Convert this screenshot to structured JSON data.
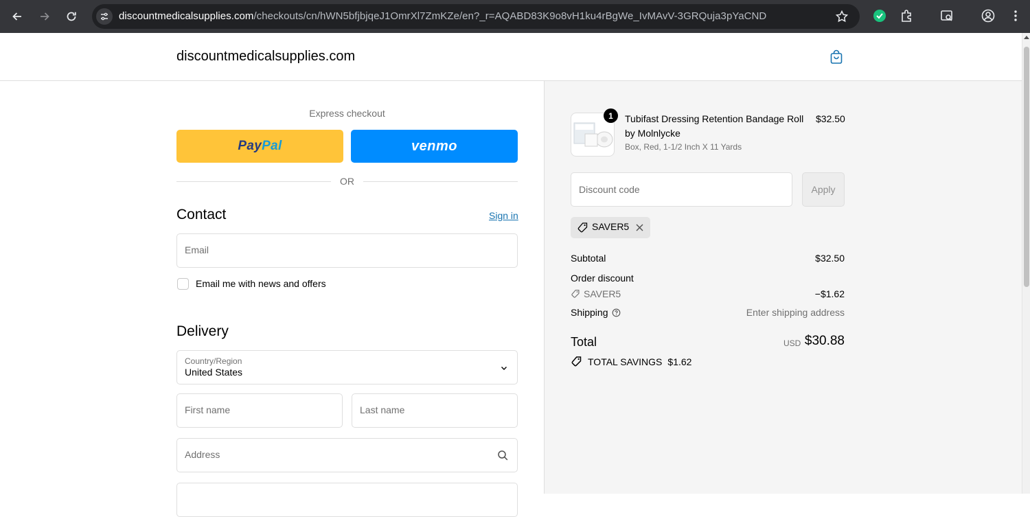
{
  "browser": {
    "url_host": "discountmedicalsupplies.com",
    "url_path": "/checkouts/cn/hWN5bfjbjqeJ1OmrXl7ZmKZe/en?_r=AQABD83K9o8vH1ku4rBgWe_IvMAvV-3GRQuja3pYaCND"
  },
  "header": {
    "store_name": "discountmedicalsupplies.com"
  },
  "express": {
    "label": "Express checkout",
    "paypal_part1": "Pay",
    "paypal_part2": "Pal",
    "venmo": "venmo",
    "or": "OR"
  },
  "contact": {
    "title": "Contact",
    "signin": "Sign in",
    "email_placeholder": "Email",
    "newsletter_label": "Email me with news and offers"
  },
  "delivery": {
    "title": "Delivery",
    "country_label": "Country/Region",
    "country_value": "United States",
    "first_name_placeholder": "First name",
    "last_name_placeholder": "Last name",
    "address_placeholder": "Address"
  },
  "summary": {
    "product": {
      "quantity": "1",
      "name": "Tubifast Dressing Retention Bandage Roll by Molnlycke",
      "variant": "Box, Red, 1-1/2 Inch X 11 Yards",
      "price": "$32.50"
    },
    "discount_placeholder": "Discount code",
    "apply_label": "Apply",
    "applied_code": "SAVER5",
    "subtotal_label": "Subtotal",
    "subtotal_value": "$32.50",
    "order_discount_label": "Order discount",
    "order_discount_code": "SAVER5",
    "order_discount_value": "−$1.62",
    "shipping_label": "Shipping",
    "shipping_value": "Enter shipping address",
    "total_label": "Total",
    "total_currency": "USD",
    "total_value": "$30.88",
    "savings_label": "TOTAL SAVINGS",
    "savings_value": "$1.62"
  }
}
